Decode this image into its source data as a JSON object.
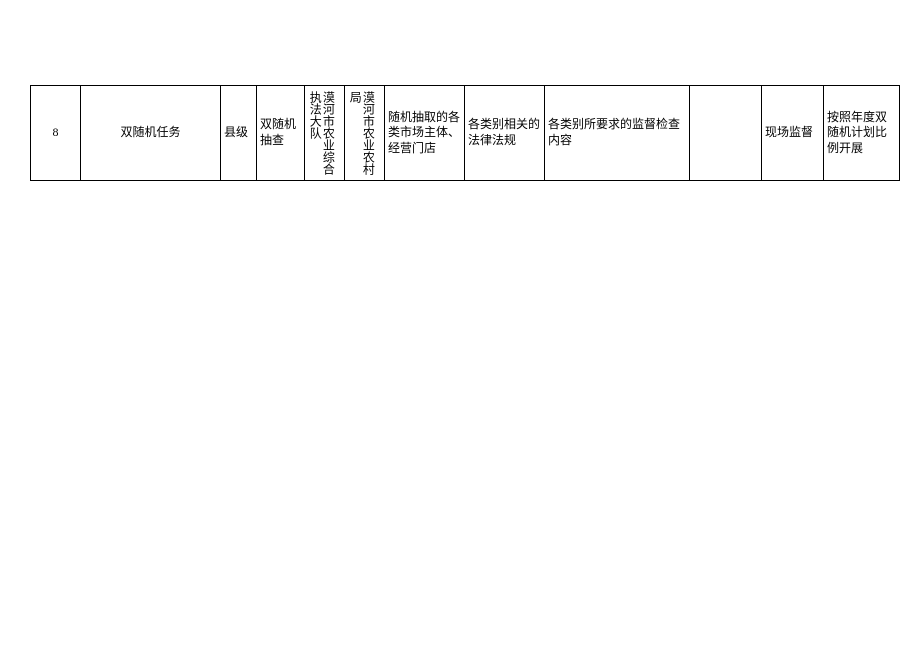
{
  "table": {
    "rows": [
      {
        "num": "8",
        "task": "双随机任务",
        "level": "县级",
        "method": "双随机抽查",
        "dept1": "漠河市农业综合执法大队",
        "dept2": "漠河市农业农村局",
        "subject": "随机抽取的各类市场主体、经营门店",
        "laws": "各类别相关的法律法规",
        "content": "各类别所要求的监督检查内容",
        "empty": "",
        "type": "现场监督",
        "plan": "按照年度双随机计划比例开展"
      }
    ]
  }
}
